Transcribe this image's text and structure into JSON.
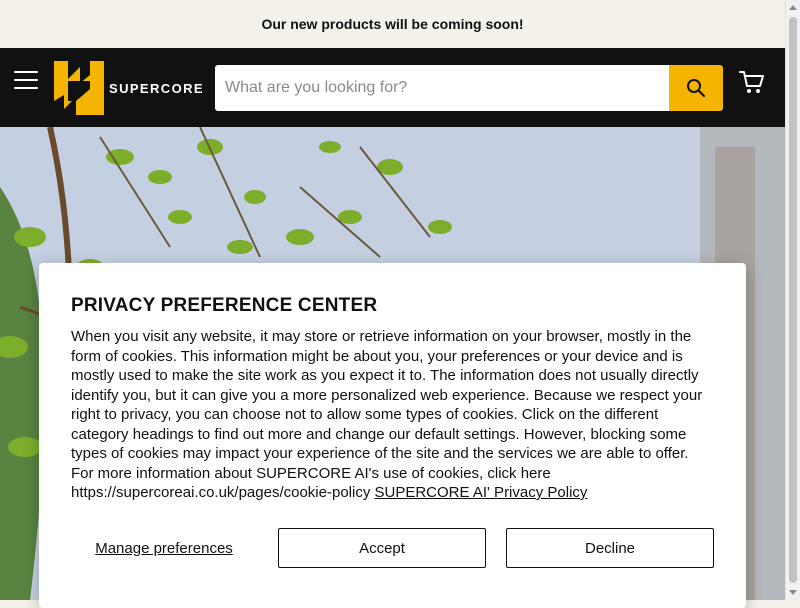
{
  "announcement": "Our new products will be coming soon!",
  "brand": {
    "name": "SUPERCORE",
    "accent_color": "#f5b400",
    "header_bg": "#111111"
  },
  "search": {
    "placeholder": "What are you looking for?"
  },
  "icons": {
    "menu": "hamburger-icon",
    "search": "search-icon",
    "cart": "cart-icon",
    "logo": "supercore-logo-icon"
  },
  "privacy": {
    "title": "PRIVACY PREFERENCE CENTER",
    "body": "When you visit any website, it may store or retrieve information on your browser, mostly in the form of cookies. This information might be about you, your preferences or your device and is mostly used to make the site work as you expect it to. The information does not usually directly identify you, but it can give you a more personalized web experience. Because we respect your right to privacy, you can choose not to allow some types of cookies. Click on the different category headings to find out more and change our default settings. However, blocking some types of cookies may impact your experience of the site and the services we are able to offer. For more information about SUPERCORE AI's use of cookies, click here https://supercoreai.co.uk/pages/cookie-policy",
    "policy_link": "SUPERCORE AI' Privacy Policy",
    "manage_label": "Manage preferences",
    "accept_label": "Accept",
    "decline_label": "Decline"
  }
}
